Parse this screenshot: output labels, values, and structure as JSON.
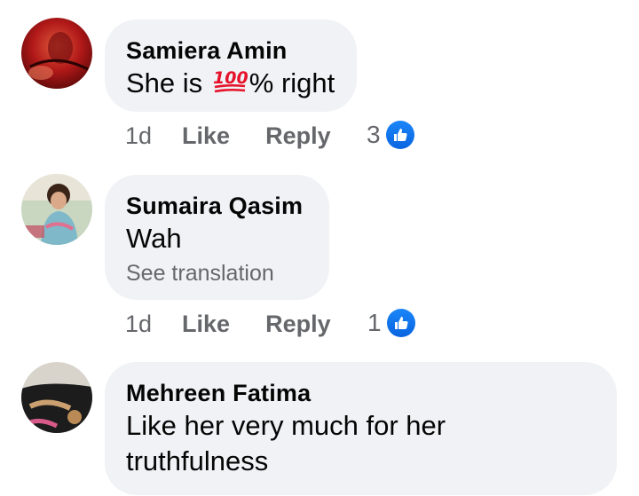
{
  "comments": [
    {
      "author": "Samiera Amin",
      "text_before": "She is ",
      "emoji": "100-emoji",
      "text_after": "% right",
      "time": "1d",
      "like_label": "Like",
      "reply_label": "Reply",
      "reaction_count": "3",
      "avatar_icon": "profile-photo"
    },
    {
      "author": "Sumaira Qasim",
      "text": "Wah",
      "see_translation": "See translation",
      "time": "1d",
      "like_label": "Like",
      "reply_label": "Reply",
      "reaction_count": "1",
      "avatar_icon": "profile-photo"
    },
    {
      "author": "Mehreen Fatima",
      "text_line1": "Like her very much for her",
      "text_line2": "truthfulness",
      "avatar_icon": "profile-photo"
    }
  ],
  "colors": {
    "bubble_bg": "#f0f2f5",
    "meta_text": "#65676b",
    "like_blue": "#1877f2"
  }
}
